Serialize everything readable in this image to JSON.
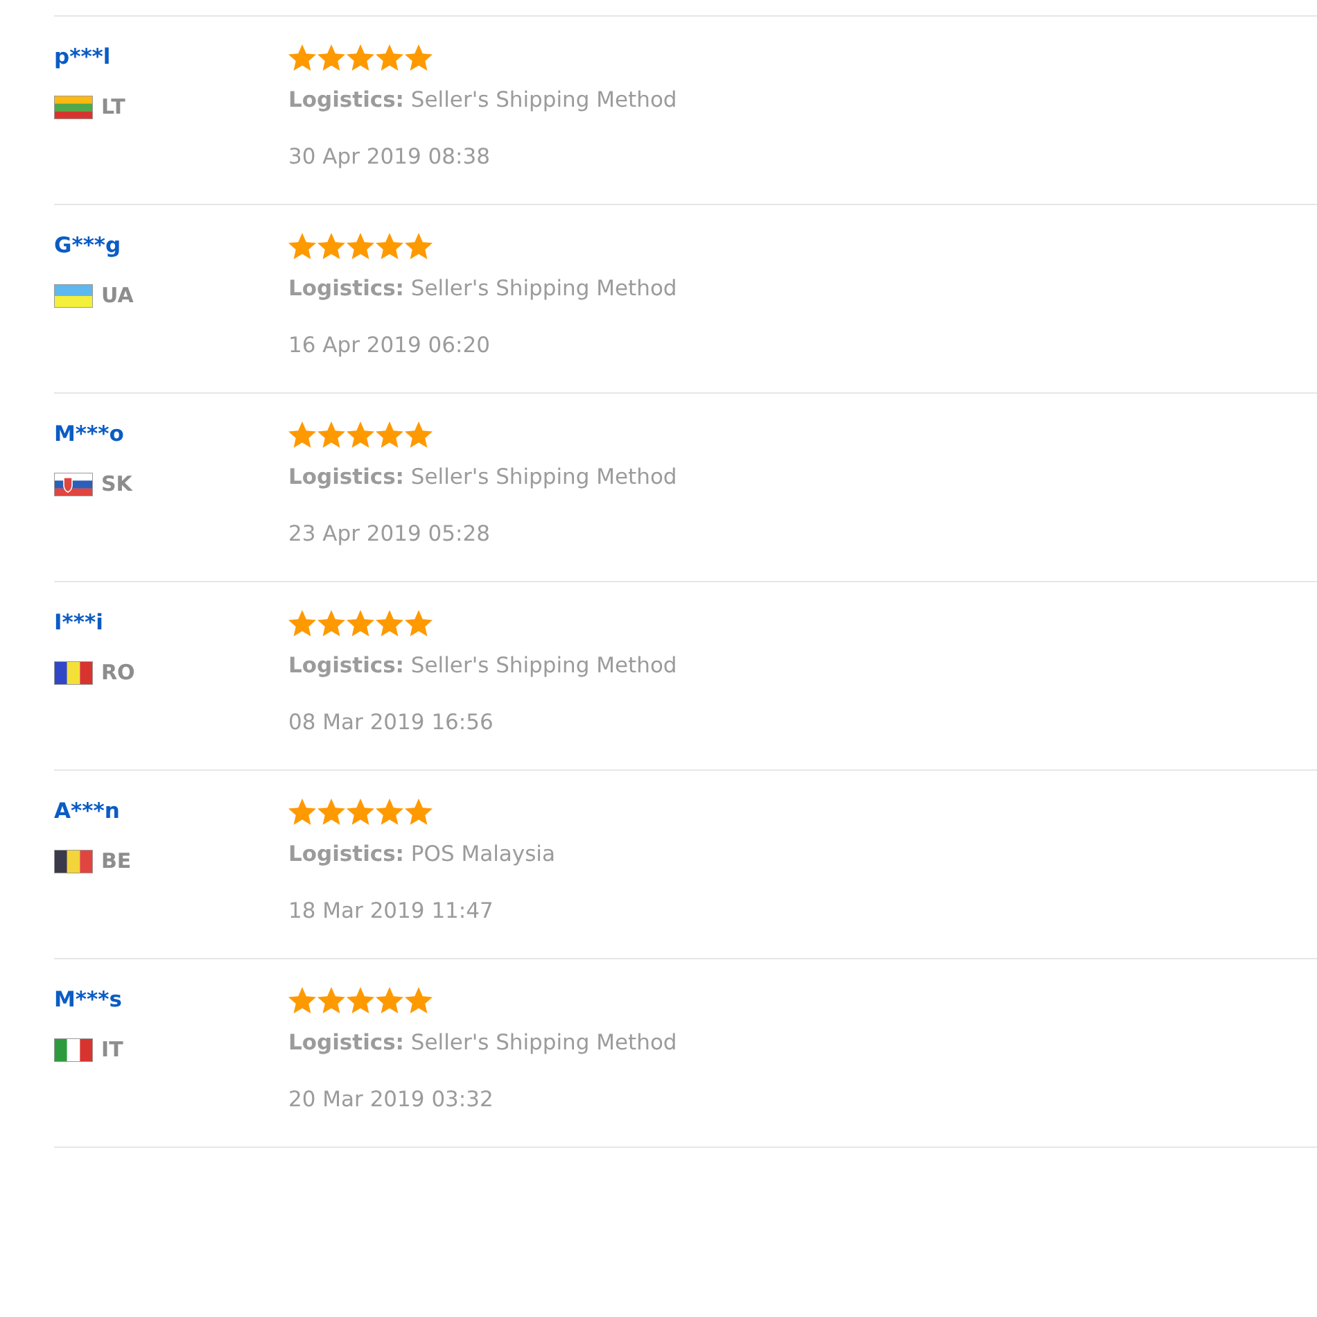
{
  "reviews": [
    {
      "name": "p***l",
      "country": "LT",
      "stars": 5,
      "logistics": "**Logistics:** Seller's Shipping Method",
      "date": "30 Apr 2019 08:38"
    },
    {
      "name": "G***g",
      "country": "UA",
      "stars": 5,
      "logistics": "**Logistics:** Seller's Shipping Method",
      "date": "16 Apr 2019 06:20"
    },
    {
      "name": "M***o",
      "country": "SK",
      "stars": 5,
      "logistics": "**Logistics:** Seller's Shipping Method",
      "date": "23 Apr 2019 05:28"
    },
    {
      "name": "I***i",
      "country": "RO",
      "stars": 5,
      "logistics": "**Logistics:** Seller's Shipping Method",
      "date": "08 Mar 2019 16:56"
    },
    {
      "name": "A***n",
      "country": "BE",
      "stars": 5,
      "logistics": "**Logistics:** POS Malaysia",
      "date": "18 Mar 2019 11:47"
    },
    {
      "name": "M***s",
      "country": "IT",
      "stars": 5,
      "logistics": "**Logistics:** Seller's Shipping Method",
      "date": "20 Mar 2019 03:32"
    }
  ]
}
